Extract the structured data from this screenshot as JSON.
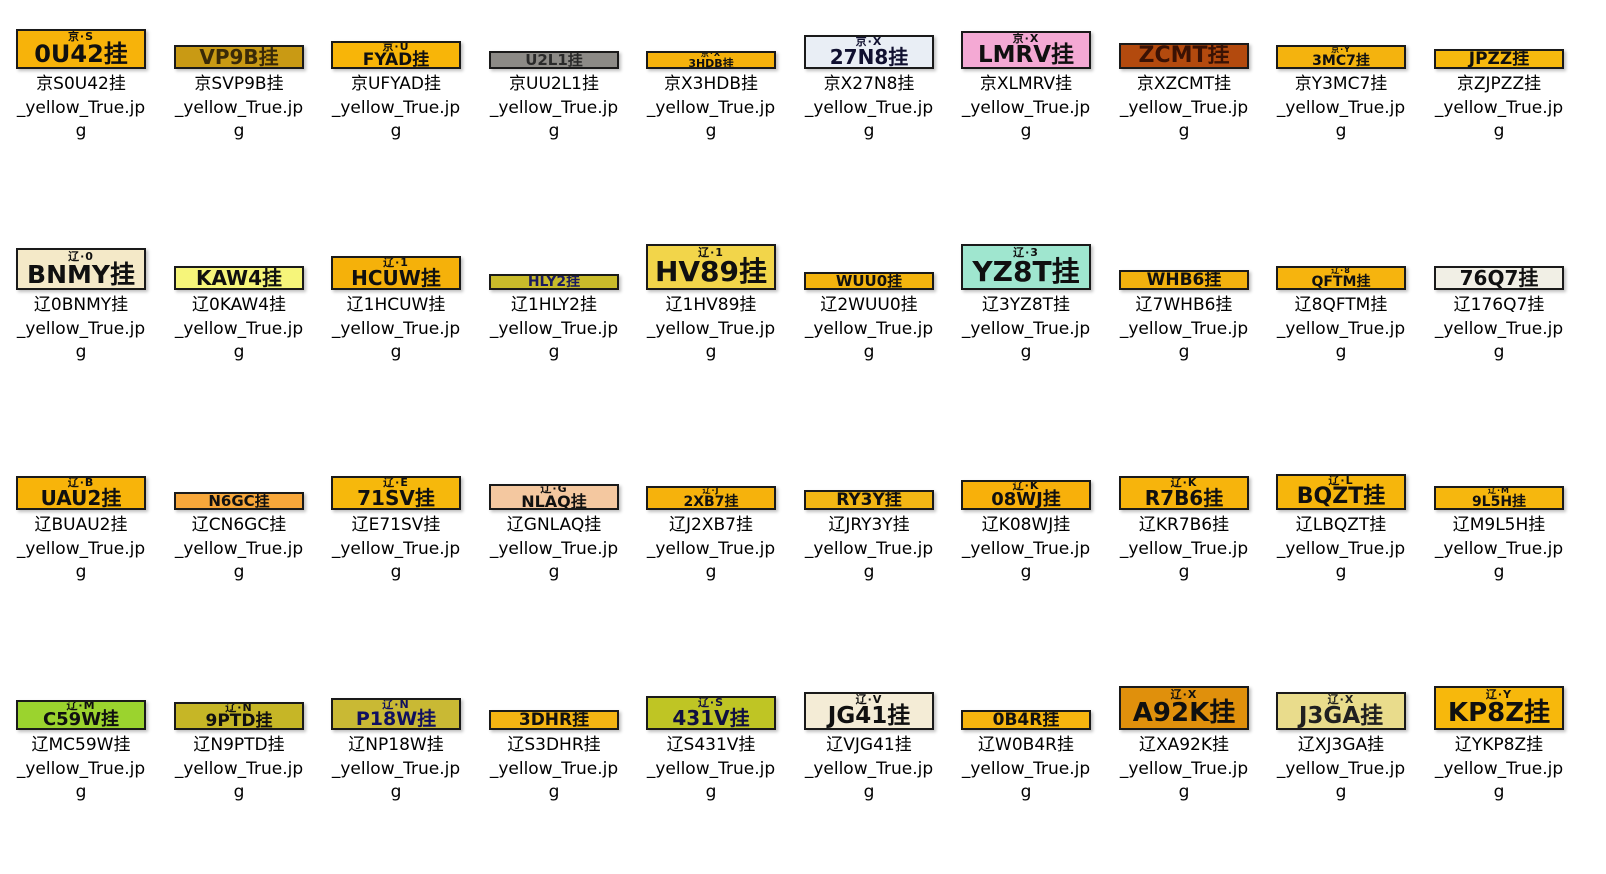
{
  "files": [
    {
      "name": "京S0U42挂",
      "line2": "_yellow_True.jp",
      "line3": "g",
      "plate_top": "京·S",
      "plate_text": "0U42挂",
      "bg": "#f7b30a",
      "h": 40,
      "fg": "#101010"
    },
    {
      "name": "京SVP9B挂",
      "line2": "_yellow_True.jp",
      "line3": "g",
      "plate_top": "",
      "plate_text": "VP9B挂",
      "bg": "#c99a14",
      "h": 24,
      "fg": "#3a2a08"
    },
    {
      "name": "京UFYAD挂",
      "line2": "_yellow_True.jp",
      "line3": "g",
      "plate_top": "京·U",
      "plate_text": "FYAD挂",
      "bg": "#f8b508",
      "h": 28,
      "fg": "#101010"
    },
    {
      "name": "京UU2L1挂",
      "line2": "_yellow_True.jp",
      "line3": "g",
      "plate_top": "",
      "plate_text": "U2L1挂",
      "bg": "#8c8a86",
      "h": 18,
      "fg": "#2a2a2a"
    },
    {
      "name": "京X3HDB挂",
      "line2": "_yellow_True.jp",
      "line3": "g",
      "plate_top": "京·X",
      "plate_text": "3HDB挂",
      "bg": "#f6b20c",
      "h": 18,
      "fg": "#101010"
    },
    {
      "name": "京X27N8挂",
      "line2": "_yellow_True.jp",
      "line3": "g",
      "plate_top": "京·X",
      "plate_text": "27N8挂",
      "bg": "#e9eef5",
      "h": 34,
      "fg": "#101030"
    },
    {
      "name": "京XLMRV挂",
      "line2": "_yellow_True.jp",
      "line3": "g",
      "plate_top": "京·X",
      "plate_text": "LMRV挂",
      "bg": "#f4a9d4",
      "h": 38,
      "fg": "#101010"
    },
    {
      "name": "京XZCMT挂",
      "line2": "_yellow_True.jp",
      "line3": "g",
      "plate_top": "",
      "plate_text": "ZCMT挂",
      "bg": "#b34a0e",
      "h": 26,
      "fg": "#3a1204"
    },
    {
      "name": "京Y3MC7挂",
      "line2": "_yellow_True.jp",
      "line3": "g",
      "plate_top": "京·Y",
      "plate_text": "3MC7挂",
      "bg": "#f4b30e",
      "h": 24,
      "fg": "#101010"
    },
    {
      "name": "京ZJPZZ挂",
      "line2": "_yellow_True.jp",
      "line3": "g",
      "plate_top": "",
      "plate_text": "JPZZ挂",
      "bg": "#f7b90e",
      "h": 20,
      "fg": "#101010"
    },
    {
      "name": "辽0BNMY挂",
      "line2": "_yellow_True.jp",
      "line3": "g",
      "plate_top": "辽·0",
      "plate_text": "BNMY挂",
      "bg": "#f4e9c8",
      "h": 42,
      "fg": "#101010"
    },
    {
      "name": "辽0KAW4挂",
      "line2": "_yellow_True.jp",
      "line3": "g",
      "plate_top": "",
      "plate_text": "KAW4挂",
      "bg": "#f6f57a",
      "h": 24,
      "fg": "#101010"
    },
    {
      "name": "辽1HCUW挂",
      "line2": "_yellow_True.jp",
      "line3": "g",
      "plate_top": "辽·1",
      "plate_text": "HCUW挂",
      "bg": "#f5b10a",
      "h": 34,
      "fg": "#101010"
    },
    {
      "name": "辽1HLY2挂",
      "line2": "_yellow_True.jp",
      "line3": "g",
      "plate_top": "",
      "plate_text": "HLY2挂",
      "bg": "#c9bb2a",
      "h": 16,
      "fg": "#1a1a60"
    },
    {
      "name": "辽1HV89挂",
      "line2": "_yellow_True.jp",
      "line3": "g",
      "plate_top": "辽·1",
      "plate_text": "HV89挂",
      "bg": "#f2d54a",
      "h": 46,
      "fg": "#101010"
    },
    {
      "name": "辽2WUU0挂",
      "line2": "_yellow_True.jp",
      "line3": "g",
      "plate_top": "",
      "plate_text": "WUU0挂",
      "bg": "#f4b40e",
      "h": 18,
      "fg": "#101010"
    },
    {
      "name": "辽3YZ8T挂",
      "line2": "_yellow_True.jp",
      "line3": "g",
      "plate_top": "辽·3",
      "plate_text": "YZ8T挂",
      "bg": "#9fe6cf",
      "h": 46,
      "fg": "#101010"
    },
    {
      "name": "辽7WHB6挂",
      "line2": "_yellow_True.jp",
      "line3": "g",
      "plate_top": "",
      "plate_text": "WHB6挂",
      "bg": "#f2b10e",
      "h": 20,
      "fg": "#101010"
    },
    {
      "name": "辽8QFTM挂",
      "line2": "_yellow_True.jp",
      "line3": "g",
      "plate_top": "辽·8",
      "plate_text": "QFTM挂",
      "bg": "#f6b40e",
      "h": 24,
      "fg": "#101010"
    },
    {
      "name": "辽176Q7挂",
      "line2": "_yellow_True.jp",
      "line3": "g",
      "plate_top": "",
      "plate_text": "76Q7挂",
      "bg": "#f1efe5",
      "h": 24,
      "fg": "#101010"
    },
    {
      "name": "辽BUAU2挂",
      "line2": "_yellow_True.jp",
      "line3": "g",
      "plate_top": "辽·B",
      "plate_text": "UAU2挂",
      "bg": "#f8b40a",
      "h": 34,
      "fg": "#101010"
    },
    {
      "name": "辽CN6GC挂",
      "line2": "_yellow_True.jp",
      "line3": "g",
      "plate_top": "",
      "plate_text": "N6GC挂",
      "bg": "#f7a73a",
      "h": 18,
      "fg": "#101010"
    },
    {
      "name": "辽E71SV挂",
      "line2": "_yellow_True.jp",
      "line3": "g",
      "plate_top": "辽·E",
      "plate_text": "71SV挂",
      "bg": "#f6b80c",
      "h": 34,
      "fg": "#101010"
    },
    {
      "name": "辽GNLAQ挂",
      "line2": "_yellow_True.jp",
      "line3": "g",
      "plate_top": "辽·G",
      "plate_text": "NLAQ挂",
      "bg": "#f4c8a0",
      "h": 26,
      "fg": "#101010"
    },
    {
      "name": "辽J2XB7挂",
      "line2": "_yellow_True.jp",
      "line3": "g",
      "plate_top": "辽·J",
      "plate_text": "2XB7挂",
      "bg": "#f6b20c",
      "h": 24,
      "fg": "#101010"
    },
    {
      "name": "辽JRY3Y挂",
      "line2": "_yellow_True.jp",
      "line3": "g",
      "plate_top": "",
      "plate_text": "RY3Y挂",
      "bg": "#f2b614",
      "h": 20,
      "fg": "#101010"
    },
    {
      "name": "辽K08WJ挂",
      "line2": "_yellow_True.jp",
      "line3": "g",
      "plate_top": "辽·K",
      "plate_text": "08WJ挂",
      "bg": "#f8b00a",
      "h": 30,
      "fg": "#101010"
    },
    {
      "name": "辽KR7B6挂",
      "line2": "_yellow_True.jp",
      "line3": "g",
      "plate_top": "辽·K",
      "plate_text": "R7B6挂",
      "bg": "#f7b40c",
      "h": 34,
      "fg": "#101010"
    },
    {
      "name": "辽LBQZT挂",
      "line2": "_yellow_True.jp",
      "line3": "g",
      "plate_top": "辽·L",
      "plate_text": "BQZT挂",
      "bg": "#f6b60c",
      "h": 36,
      "fg": "#101010"
    },
    {
      "name": "辽M9L5H挂",
      "line2": "_yellow_True.jp",
      "line3": "g",
      "plate_top": "辽·M",
      "plate_text": "9L5H挂",
      "bg": "#f6b70e",
      "h": 24,
      "fg": "#101010"
    },
    {
      "name": "辽MC59W挂",
      "line2": "_yellow_True.jp",
      "line3": "g",
      "plate_top": "辽·M",
      "plate_text": "C59W挂",
      "bg": "#9bd32e",
      "h": 30,
      "fg": "#101010"
    },
    {
      "name": "辽N9PTD挂",
      "line2": "_yellow_True.jp",
      "line3": "g",
      "plate_top": "辽·N",
      "plate_text": "9PTD挂",
      "bg": "#c6b626",
      "h": 28,
      "fg": "#101010"
    },
    {
      "name": "辽NP18W挂",
      "line2": "_yellow_True.jp",
      "line3": "g",
      "plate_top": "辽·N",
      "plate_text": "P18W挂",
      "bg": "#c9b934",
      "h": 32,
      "fg": "#101060"
    },
    {
      "name": "辽S3DHR挂",
      "line2": "_yellow_True.jp",
      "line3": "g",
      "plate_top": "",
      "plate_text": "3DHR挂",
      "bg": "#f4b412",
      "h": 20,
      "fg": "#101010"
    },
    {
      "name": "辽S431V挂",
      "line2": "_yellow_True.jp",
      "line3": "g",
      "plate_top": "辽·S",
      "plate_text": "431V挂",
      "bg": "#bfc524",
      "h": 34,
      "fg": "#101040"
    },
    {
      "name": "辽VJG41挂",
      "line2": "_yellow_True.jp",
      "line3": "g",
      "plate_top": "辽·V",
      "plate_text": "JG41挂",
      "bg": "#f4ecd6",
      "h": 38,
      "fg": "#101010"
    },
    {
      "name": "辽W0B4R挂",
      "line2": "_yellow_True.jp",
      "line3": "g",
      "plate_top": "",
      "plate_text": "0B4R挂",
      "bg": "#f6b40e",
      "h": 20,
      "fg": "#101010"
    },
    {
      "name": "辽XA92K挂",
      "line2": "_yellow_True.jp",
      "line3": "g",
      "plate_top": "辽·X",
      "plate_text": "A92K挂",
      "bg": "#e0900c",
      "h": 44,
      "fg": "#101010"
    },
    {
      "name": "辽XJ3GA挂",
      "line2": "_yellow_True.jp",
      "line3": "g",
      "plate_top": "辽·X",
      "plate_text": "J3GA挂",
      "bg": "#e9dc8c",
      "h": 38,
      "fg": "#202020"
    },
    {
      "name": "辽YKP8Z挂",
      "line2": "_yellow_True.jp",
      "line3": "g",
      "plate_top": "辽·Y",
      "plate_text": "KP8Z挂",
      "bg": "#f7b80c",
      "h": 44,
      "fg": "#101010"
    }
  ]
}
